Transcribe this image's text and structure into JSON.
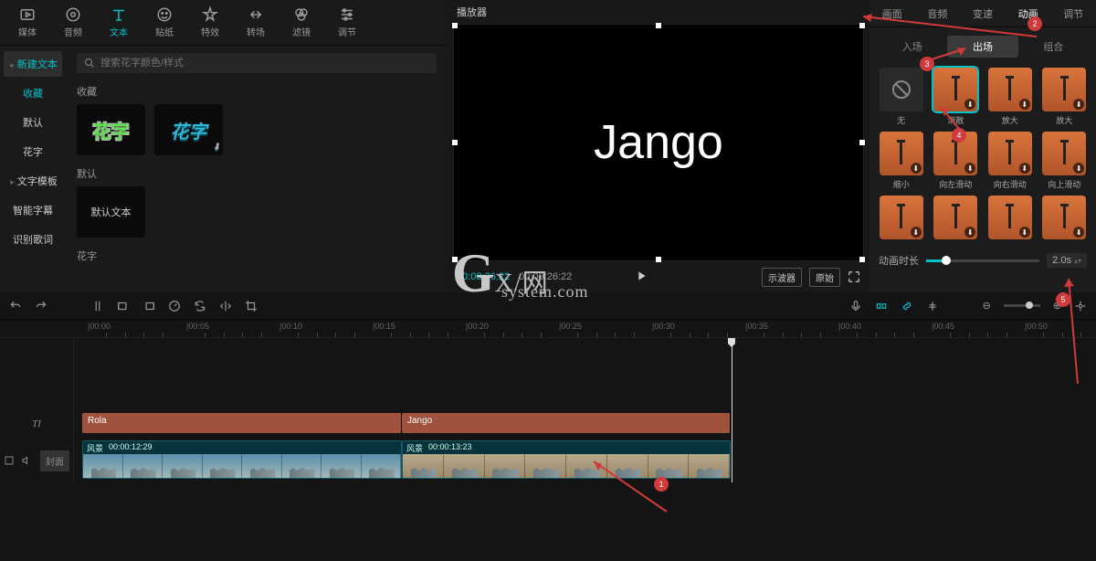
{
  "toolbar": [
    {
      "label": "媒体",
      "icon": "media"
    },
    {
      "label": "音频",
      "icon": "audio"
    },
    {
      "label": "文本",
      "icon": "text",
      "active": true
    },
    {
      "label": "贴纸",
      "icon": "sticker"
    },
    {
      "label": "特效",
      "icon": "effect"
    },
    {
      "label": "转场",
      "icon": "transition"
    },
    {
      "label": "滤镜",
      "icon": "filter"
    },
    {
      "label": "调节",
      "icon": "adjust"
    }
  ],
  "sidebar": [
    {
      "label": "新建文本",
      "active": true,
      "chev": true
    },
    {
      "label": "收藏",
      "accent": true
    },
    {
      "label": "默认"
    },
    {
      "label": "花字"
    },
    {
      "label": "文字模板",
      "chev": true
    },
    {
      "label": "智能字幕"
    },
    {
      "label": "识别歌词"
    }
  ],
  "search": {
    "placeholder": "搜索花字颜色/样式"
  },
  "sections": {
    "fav": "收藏",
    "def": "默认",
    "huazi": "花字"
  },
  "templates": {
    "hz1": "花字",
    "hz2": "花字",
    "def": "默认文本"
  },
  "preview": {
    "title": "播放器",
    "text": "Jango",
    "cur_time": "00:00:26:22",
    "total_time": "00:00:26:22",
    "btn_scope": "示波器",
    "btn_orig": "原始"
  },
  "right_tabs": [
    "画面",
    "音频",
    "变速",
    "动画",
    "调节"
  ],
  "right_active": 3,
  "sub_tabs": [
    "入场",
    "出场",
    "组合"
  ],
  "sub_active": 1,
  "anims": [
    {
      "label": "无",
      "none": true
    },
    {
      "label": "消散",
      "selected": true
    },
    {
      "label": "放大"
    },
    {
      "label": "放大"
    },
    {
      "label": "缩小"
    },
    {
      "label": "向左滑动"
    },
    {
      "label": "向右滑动"
    },
    {
      "label": "向上滑动"
    },
    {
      "label": ""
    },
    {
      "label": ""
    },
    {
      "label": ""
    },
    {
      "label": ""
    }
  ],
  "duration": {
    "label": "动画时长",
    "value": "2.0s"
  },
  "ruler_marks": [
    {
      "t": "00:00",
      "pct": 8
    },
    {
      "t": "00:05",
      "pct": 17
    },
    {
      "t": "00:10",
      "pct": 25.5
    },
    {
      "t": "00:15",
      "pct": 34
    },
    {
      "t": "00:20",
      "pct": 42.5
    },
    {
      "t": "00:25",
      "pct": 51
    },
    {
      "t": "00:30",
      "pct": 59.5
    },
    {
      "t": "00:35",
      "pct": 68
    },
    {
      "t": "00:40",
      "pct": 76.5
    },
    {
      "t": "00:45",
      "pct": 85
    },
    {
      "t": "00:50",
      "pct": 93.5
    }
  ],
  "text_clips": [
    {
      "name": "Rola"
    },
    {
      "name": "Jango"
    }
  ],
  "video_clips": [
    {
      "name": "风景",
      "time": "00:00:12:29"
    },
    {
      "name": "风景",
      "time": "00:00:13:23"
    }
  ],
  "cover": "封面",
  "watermark": {
    "g": "G",
    "top": "X/网",
    "sub": "system.com"
  }
}
